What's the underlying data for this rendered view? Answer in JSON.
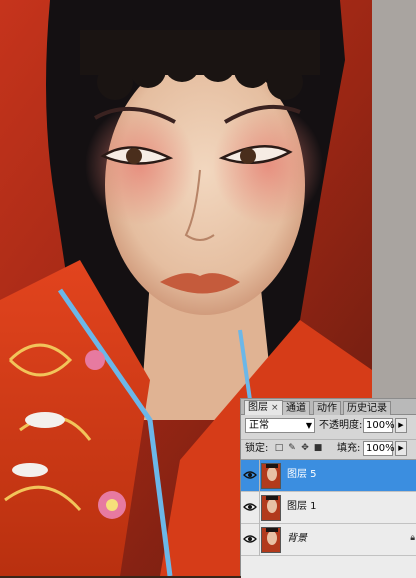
{
  "panel": {
    "tabs": [
      {
        "label": "图层",
        "close": "×"
      },
      {
        "label": "通道"
      },
      {
        "label": "动作"
      },
      {
        "label": "历史记录"
      }
    ],
    "blend_mode": "正常",
    "opacity_label": "不透明度:",
    "opacity_value": "100%",
    "lock_label": "锁定:",
    "fill_label": "填充:",
    "fill_value": "100%",
    "layers": [
      {
        "name": "图层 5",
        "selected": true,
        "visible": true
      },
      {
        "name": "图层 1",
        "selected": false,
        "visible": true
      },
      {
        "name": "背景",
        "selected": false,
        "visible": true,
        "locked": true
      }
    ]
  },
  "icons": {
    "eye": "eye-icon",
    "lock": "lock-icon",
    "dropdown": "chevron-down-icon",
    "spin": "chevron-right-icon"
  },
  "colors": {
    "selection": "#3b8ee0",
    "panel_bg": "#d6d6d6"
  }
}
